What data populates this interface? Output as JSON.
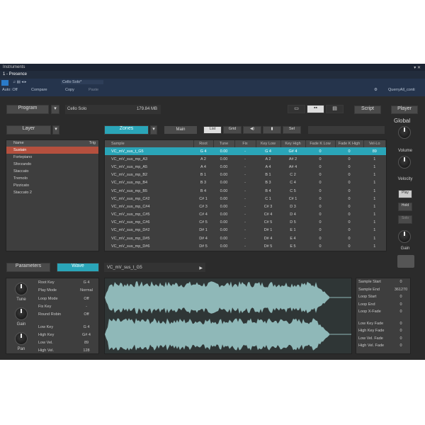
{
  "window": {
    "title": "Instruments",
    "tab": "1 - Presence",
    "controls": "▾ ✕"
  },
  "toolbar": {
    "auto_off": "Auto: Off",
    "compare": "Compare",
    "copy": "Copy",
    "paste": "Paste",
    "preset": "Cello Solo*",
    "user": "QuerryAll_conti"
  },
  "program": {
    "label": "Program",
    "name": "Cello Solo",
    "size": "179.84 MB",
    "script": "Script",
    "player": "Player"
  },
  "layer": {
    "label": "Layer",
    "zone_label": "Zones",
    "main": "Main",
    "filter_buttons": [
      "List",
      "Grid",
      "",
      "",
      "Sel"
    ]
  },
  "layer_list": {
    "headers": [
      "Name",
      "Trig"
    ],
    "items": [
      "Sustain",
      "Fortepiano",
      "Sforzando",
      "Staccato",
      "Tremolo",
      "Pizzicato",
      "Staccato 2"
    ]
  },
  "zones": {
    "headers": [
      "Sample",
      "Root",
      "Tune",
      "Fix",
      "Key Low",
      "Key High",
      "Fade K Low",
      "Fade K High",
      "Vel-Lo"
    ],
    "rows": [
      [
        "VC_mV_sus_t_G5",
        "G 4",
        "0.00",
        "-",
        "G 4",
        "G# 4",
        "0",
        "0",
        "89"
      ],
      [
        "VC_mV_sus_mp_A3",
        "A 2",
        "0.00",
        "-",
        "A 2",
        "A# 2",
        "0",
        "0",
        "1"
      ],
      [
        "VC_mV_sus_mp_A5",
        "A 4",
        "0.00",
        "-",
        "A 4",
        "A# 4",
        "0",
        "0",
        "1"
      ],
      [
        "VC_mV_sus_mp_B2",
        "B 1",
        "0.00",
        "-",
        "B 1",
        "C 2",
        "0",
        "0",
        "1"
      ],
      [
        "VC_mV_sus_mp_B4",
        "B 3",
        "0.00",
        "-",
        "B 3",
        "C 4",
        "0",
        "0",
        "1"
      ],
      [
        "VC_mV_sus_mp_B5",
        "B 4",
        "0.00",
        "-",
        "B 4",
        "C 5",
        "0",
        "0",
        "1"
      ],
      [
        "VC_mV_sus_mp_C#2",
        "C# 1",
        "0.00",
        "-",
        "C 1",
        "C# 1",
        "0",
        "0",
        "1"
      ],
      [
        "VC_mV_sus_mp_C#4",
        "C# 3",
        "0.00",
        "-",
        "C# 3",
        "D 3",
        "0",
        "0",
        "1"
      ],
      [
        "VC_mV_sus_mp_C#5",
        "C# 4",
        "0.00",
        "-",
        "C# 4",
        "D 4",
        "0",
        "0",
        "1"
      ],
      [
        "VC_mV_sus_mp_C#6",
        "C# 5",
        "0.00",
        "-",
        "C# 5",
        "D 5",
        "0",
        "0",
        "1"
      ],
      [
        "VC_mV_sus_mp_D#2",
        "D# 1",
        "0.00",
        "-",
        "D# 1",
        "E 1",
        "0",
        "0",
        "1"
      ],
      [
        "VC_mV_sus_mp_D#5",
        "D# 4",
        "0.00",
        "-",
        "D# 4",
        "E 4",
        "0",
        "0",
        "1"
      ],
      [
        "VC_mV_sus_mp_D#6",
        "D# 5",
        "0.00",
        "-",
        "D# 5",
        "E 5",
        "0",
        "0",
        "1"
      ]
    ]
  },
  "global": {
    "title": "Global",
    "volume": "Volume",
    "velocity": "Velocity",
    "play": "Play",
    "hold": "Hold",
    "solo": "Solo",
    "gain": "Gain"
  },
  "bottom": {
    "tab_parameters": "Parameters",
    "tab_wave": "Wave",
    "sample": "VC_mV_sus_t_G5"
  },
  "knobs": [
    "Tune",
    "Gain",
    "Pan"
  ],
  "params": [
    [
      "Root Key",
      "G 4"
    ],
    [
      "Play Mode",
      "Normal"
    ],
    [
      "Loop Mode",
      "Off"
    ],
    [
      "Fix Key",
      "-"
    ],
    [
      "Round Robin",
      "Off"
    ],
    [
      "Low Key",
      "G 4"
    ],
    [
      "High Key",
      "G# 4"
    ],
    [
      "Low Vel.",
      "89"
    ],
    [
      "High Vel.",
      "128"
    ]
  ],
  "info": [
    [
      "Sample Start",
      "0"
    ],
    [
      "Sample End",
      "361270"
    ],
    [
      "Loop Start",
      "0"
    ],
    [
      "Loop End",
      "0"
    ],
    [
      "Loop X-Fade",
      "0"
    ],
    [
      "Low Key Fade",
      "0"
    ],
    [
      "High Key Fade",
      "0"
    ],
    [
      "Low Vel. Fade",
      "0"
    ],
    [
      "High Vel. Fade",
      "0"
    ]
  ],
  "colors": {
    "accent": "#2aa5b8",
    "layer_selected": "#b5503e",
    "wave": "#8fb8b8"
  }
}
